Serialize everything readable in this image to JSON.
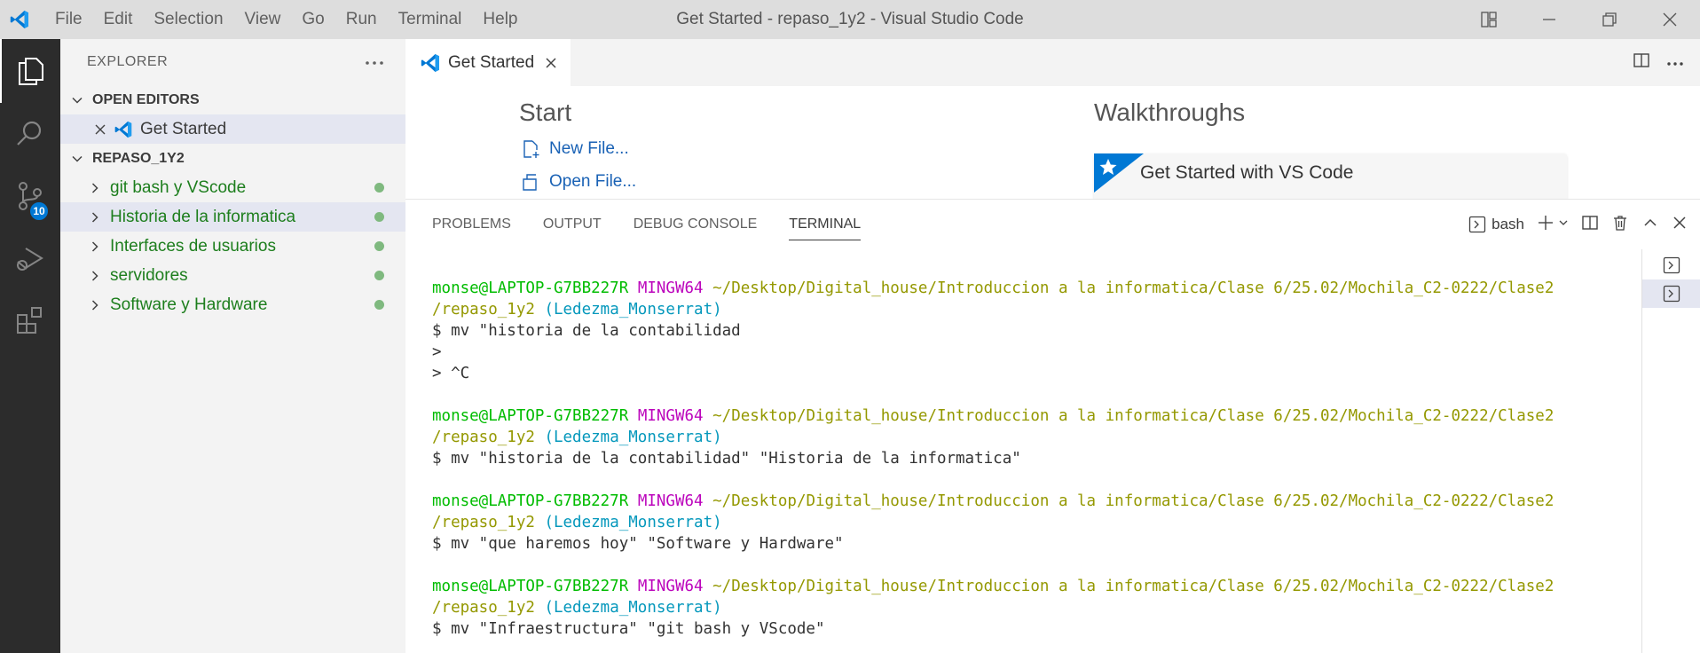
{
  "titlebar": {
    "menu": [
      "File",
      "Edit",
      "Selection",
      "View",
      "Go",
      "Run",
      "Terminal",
      "Help"
    ],
    "window_title": "Get Started - repaso_1y2 - Visual Studio Code"
  },
  "activitybar": {
    "source_control_badge": "10"
  },
  "sidebar": {
    "title": "EXPLORER",
    "open_editors_label": "OPEN EDITORS",
    "open_editors": [
      {
        "label": "Get Started"
      }
    ],
    "folder_label": "REPASO_1Y2",
    "folders": [
      {
        "label": "git bash y VScode"
      },
      {
        "label": "Historia de la informatica"
      },
      {
        "label": "Interfaces de usuarios"
      },
      {
        "label": "servidores"
      },
      {
        "label": "Software y Hardware"
      }
    ]
  },
  "editor": {
    "tab_label": "Get Started",
    "welcome": {
      "start_heading": "Start",
      "new_file": "New File...",
      "open_file": "Open File...",
      "walkthroughs_heading": "Walkthroughs",
      "walkthrough_card": "Get Started with VS Code"
    }
  },
  "panel": {
    "tabs": [
      "PROBLEMS",
      "OUTPUT",
      "DEBUG CONSOLE",
      "TERMINAL"
    ],
    "active_tab": "TERMINAL",
    "shell_label": "bash",
    "terminal": {
      "user": "monse@LAPTOP-G7BB227R",
      "host": "MINGW64",
      "path_line1": "~/Desktop/Digital_house/Introduccion a la informatica/Clase 6/25.02/Mochila_C2-0222/Clase2",
      "path_line2": "/repaso_1y2",
      "branch": "(Ledezma_Monserrat)",
      "b1_cmd": "$ mv \"historia de la contabilidad",
      "b1_cont1": ">",
      "b1_cont2": "> ^C",
      "b2_cmd": "$ mv \"historia de la contabilidad\" \"Historia de la informatica\"",
      "b3_cmd": "$ mv \"que haremos hoy\" \"Software y Hardware\"",
      "b4_cmd": "$ mv \"Infraestructura\" \"git bash y VScode\""
    }
  },
  "colors": {
    "accent": "#0078d4",
    "git_added": "#7fb97f",
    "term_user": "#00bc00",
    "term_host": "#bc05bc",
    "term_path": "#949800",
    "term_branch": "#0598bc"
  }
}
